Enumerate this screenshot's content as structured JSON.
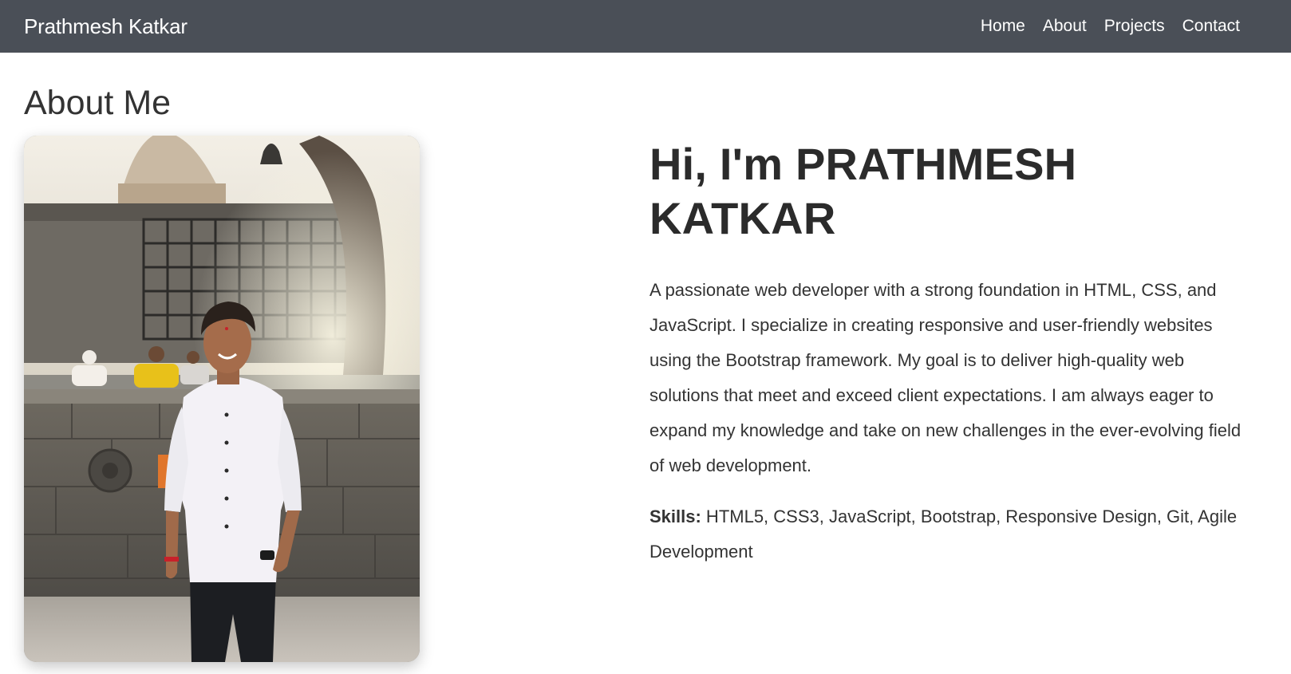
{
  "navbar": {
    "brand": "Prathmesh Katkar",
    "links": [
      {
        "label": "Home"
      },
      {
        "label": "About"
      },
      {
        "label": "Projects"
      },
      {
        "label": "Contact"
      }
    ],
    "background": "#4a4f57"
  },
  "about": {
    "title": "About Me",
    "photo_icon": "profile-photo",
    "greeting": "Hi, I'm PRATHMESH KATKAR",
    "bio": "A passionate web developer with a strong foundation in HTML, CSS, and JavaScript. I specialize in creating responsive and user-friendly websites using the Bootstrap framework. My goal is to deliver high-quality web solutions that meet and exceed client expectations. I am always eager to expand my knowledge and take on new challenges in the ever-evolving field of web development.",
    "skills_label": "Skills:",
    "skills_value": " HTML5, CSS3, JavaScript, Bootstrap, Responsive Design, Git, Agile Development"
  }
}
